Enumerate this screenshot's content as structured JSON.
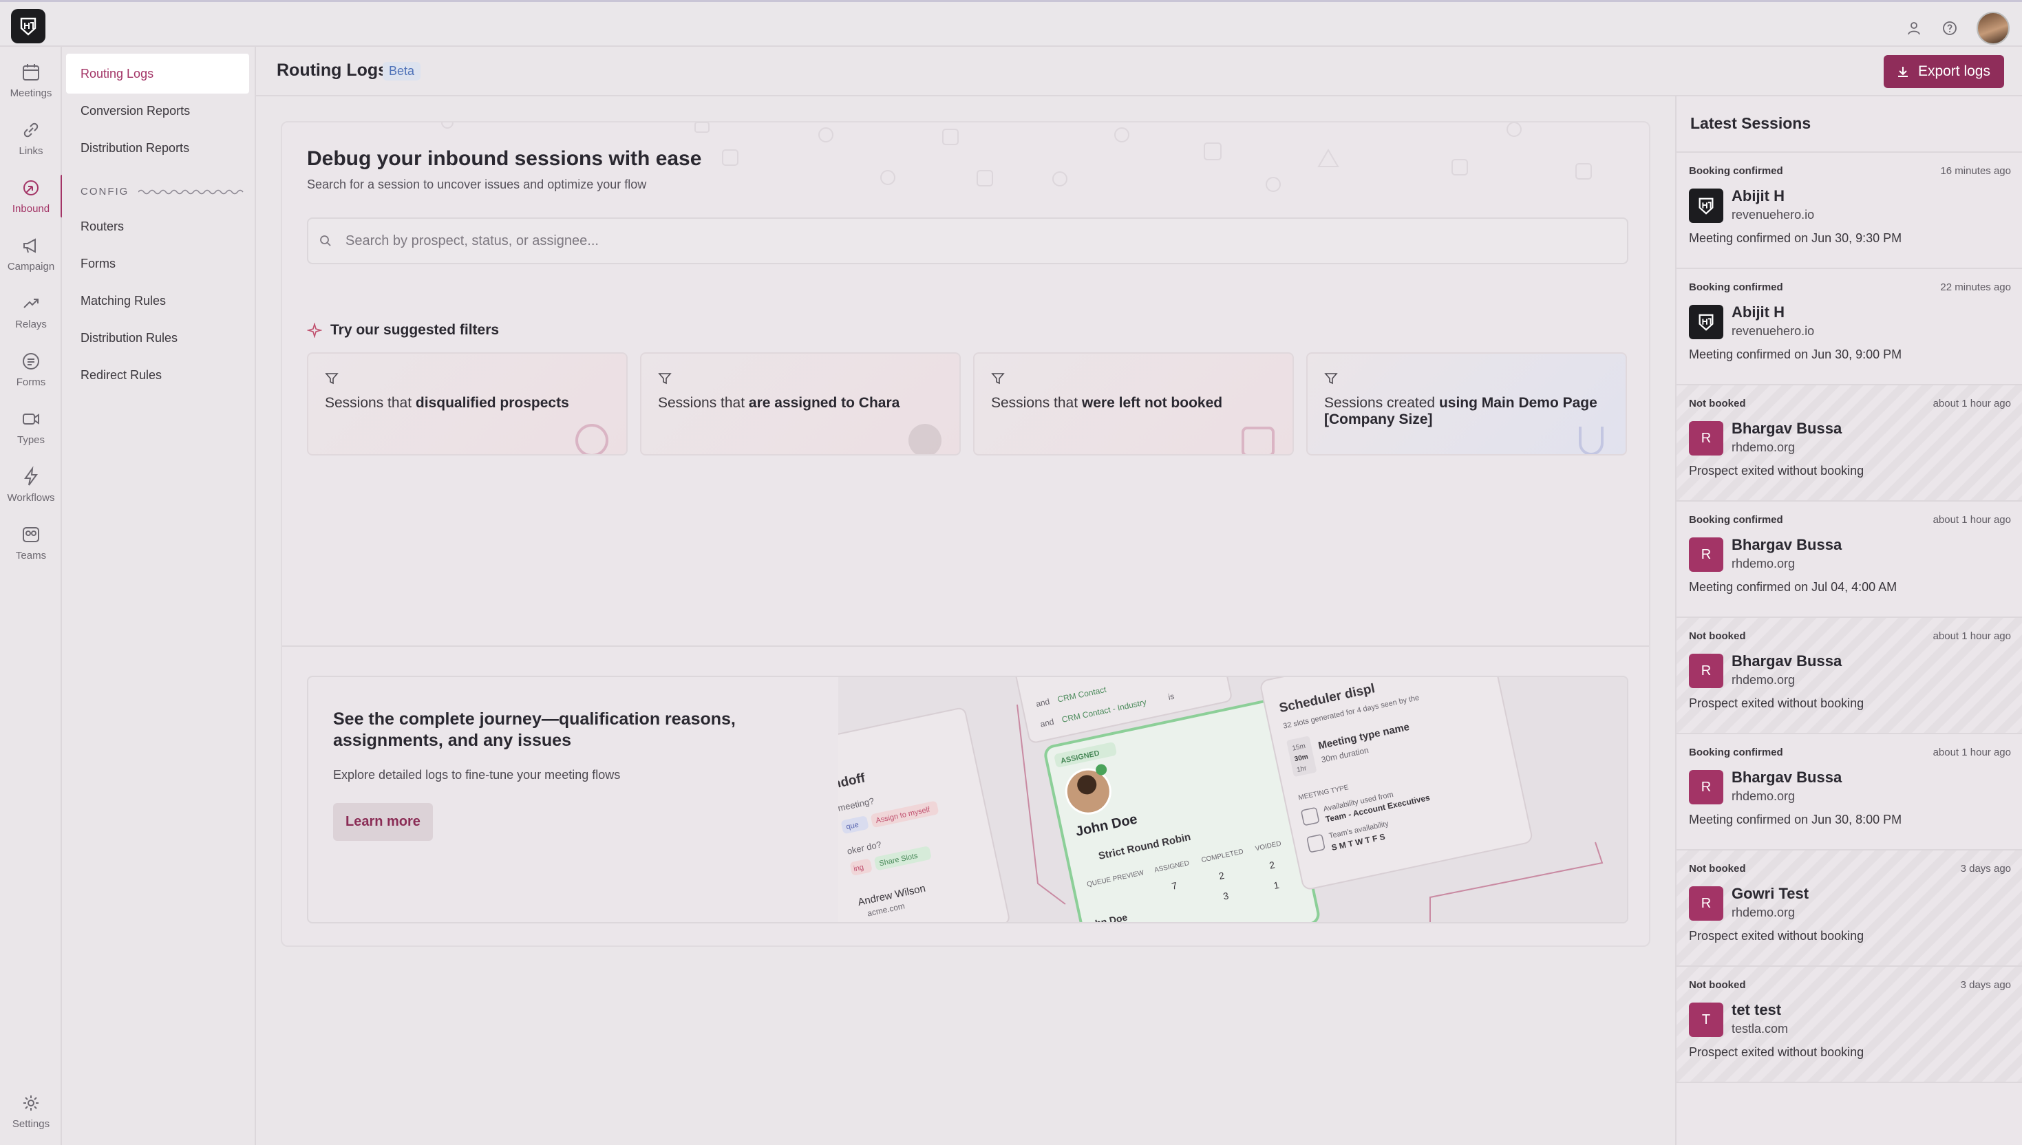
{
  "app": {
    "logo_icon": "revenuehero-logo-icon"
  },
  "colors": {
    "accent": "#a33466",
    "button": "#8f2d5a",
    "beta": "#4f72b8"
  },
  "rail": [
    {
      "key": "meetings",
      "label": "Meetings",
      "icon": "calendar-icon"
    },
    {
      "key": "links",
      "label": "Links",
      "icon": "link-icon"
    },
    {
      "key": "inbound",
      "label": "Inbound",
      "icon": "inbound-icon",
      "active": true
    },
    {
      "key": "campaign",
      "label": "Campaign",
      "icon": "megaphone-icon"
    },
    {
      "key": "relays",
      "label": "Relays",
      "icon": "relay-icon"
    },
    {
      "key": "forms",
      "label": "Forms",
      "icon": "form-icon"
    },
    {
      "key": "types",
      "label": "Types",
      "icon": "video-icon"
    },
    {
      "key": "workflows",
      "label": "Workflows",
      "icon": "lightning-icon"
    },
    {
      "key": "teams",
      "label": "Teams",
      "icon": "teams-icon"
    },
    {
      "key": "settings",
      "label": "Settings",
      "icon": "gear-icon"
    }
  ],
  "subnav": {
    "top": [
      "Routing Logs",
      "Conversion Reports",
      "Distribution Reports"
    ],
    "config_label": "CONFIG",
    "config": [
      "Routers",
      "Forms",
      "Matching Rules",
      "Distribution Rules",
      "Redirect Rules"
    ]
  },
  "header": {
    "title": "Routing Logs",
    "badge": "Beta",
    "export_label": "Export logs"
  },
  "hero": {
    "title": "Debug your inbound sessions with ease",
    "subtitle": "Search for a session to uncover issues and optimize your flow",
    "search_placeholder": "Search by prospect, status, or assignee...",
    "suggest_title": "Try our suggested filters"
  },
  "filters": [
    {
      "prefix": "Sessions that ",
      "bold": "disqualified prospects"
    },
    {
      "prefix": "Sessions that ",
      "bold": "are assigned to Chara"
    },
    {
      "prefix": "Sessions that ",
      "bold": "were left not booked"
    },
    {
      "prefix": "Sessions created ",
      "bold": "using Main Demo Page [Company Size]"
    }
  ],
  "promo": {
    "title": "See the complete journey—qualification reasons, assignments, and any issues",
    "subtitle": "Explore detailed logs to fine-tune your meeting flows",
    "button": "Learn more",
    "art": {
      "card_badge": "ASSIGNED",
      "card_name": "John Doe",
      "card_strategy": "Strict Round Robin",
      "card_cols": [
        "QUEUE PREVIEW",
        "ASSIGNED",
        "COMPLETED",
        "VOIDED"
      ],
      "card_row1": [
        "",
        "7",
        "2",
        "2"
      ],
      "card_row2": [
        "hn Doe",
        "",
        "3",
        "1"
      ],
      "crm1": "CRM Contact",
      "crm2": "CRM Contact - Industry",
      "and_word": "and",
      "is_word": "is",
      "handoff": "ndoff",
      "meeting_q": "meeting?",
      "tag1": "Assign to myself",
      "tag2": "que",
      "booker_q": "oker do?",
      "tag3": "Share Slots",
      "tag4": "ing",
      "person": "Andrew Wilson",
      "person_email": "acme.com",
      "sched_title": "Scheduler displ",
      "sched_sub": "32 slots generated for 4 days seen by the",
      "meeting_type": "Meeting type name",
      "duration": "30m duration",
      "mt_label": "MEETING TYPE",
      "avail_from": "Availability used from",
      "avail_team": "Team - Account Executives",
      "team_avail": "Team's availability",
      "days": "S M T W T F S",
      "chip1": "15m",
      "chip2": "30m",
      "chip3": "1hr"
    }
  },
  "sessions": {
    "title": "Latest Sessions",
    "items": [
      {
        "status": "Booking confirmed",
        "time": "16 minutes ago",
        "name": "Abijit H",
        "domain": "revenuehero.io",
        "desc": "Meeting confirmed on Jun 30, 9:30 PM",
        "avatar": "logo",
        "striped": false
      },
      {
        "status": "Booking confirmed",
        "time": "22 minutes ago",
        "name": "Abijit H",
        "domain": "revenuehero.io",
        "desc": "Meeting confirmed on Jun 30, 9:00 PM",
        "avatar": "logo",
        "striped": false
      },
      {
        "status": "Not booked",
        "time": "about 1 hour ago",
        "name": "Bhargav Bussa",
        "domain": "rhdemo.org",
        "desc": "Prospect exited without booking",
        "avatar": "R",
        "striped": true
      },
      {
        "status": "Booking confirmed",
        "time": "about 1 hour ago",
        "name": "Bhargav Bussa",
        "domain": "rhdemo.org",
        "desc": "Meeting confirmed on Jul 04, 4:00 AM",
        "avatar": "R",
        "striped": false
      },
      {
        "status": "Not booked",
        "time": "about 1 hour ago",
        "name": "Bhargav Bussa",
        "domain": "rhdemo.org",
        "desc": "Prospect exited without booking",
        "avatar": "R",
        "striped": true
      },
      {
        "status": "Booking confirmed",
        "time": "about 1 hour ago",
        "name": "Bhargav Bussa",
        "domain": "rhdemo.org",
        "desc": "Meeting confirmed on Jun 30, 8:00 PM",
        "avatar": "R",
        "striped": false
      },
      {
        "status": "Not booked",
        "time": "3 days ago",
        "name": "Gowri Test",
        "domain": "rhdemo.org",
        "desc": "Prospect exited without booking",
        "avatar": "R",
        "striped": true
      },
      {
        "status": "Not booked",
        "time": "3 days ago",
        "name": "tet test",
        "domain": "testla.com",
        "desc": "Prospect exited without booking",
        "avatar": "T",
        "striped": true
      }
    ]
  }
}
